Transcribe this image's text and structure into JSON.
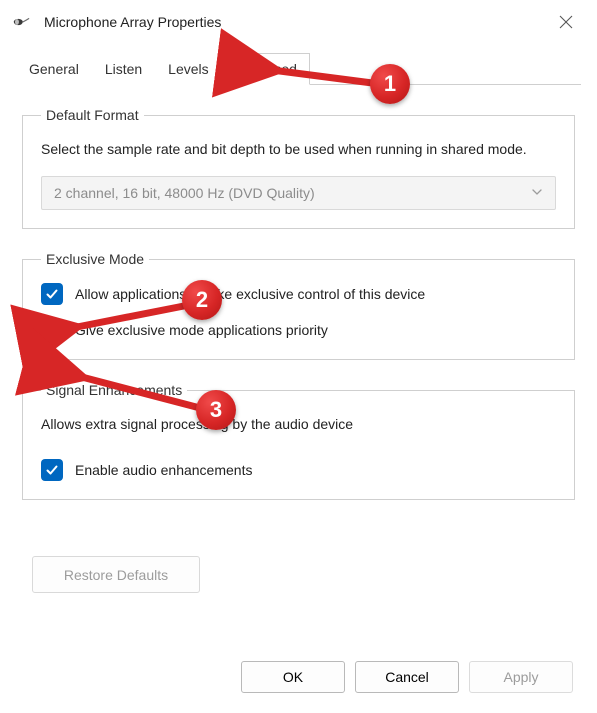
{
  "titlebar": {
    "title": "Microphone Array Properties"
  },
  "tabs": {
    "general": "General",
    "listen": "Listen",
    "levels": "Levels",
    "advanced": "Advanced"
  },
  "defaultFormat": {
    "legend": "Default Format",
    "description": "Select the sample rate and bit depth to be used when running in shared mode.",
    "selectValue": "2 channel, 16 bit, 48000 Hz (DVD Quality)"
  },
  "exclusiveMode": {
    "legend": "Exclusive Mode",
    "allowControl": "Allow applications to take exclusive control of this device",
    "givePriority": "Give exclusive mode applications priority"
  },
  "signalEnhancements": {
    "legend": "Signal Enhancements",
    "description": "Allows extra signal processing by the audio device",
    "enable": "Enable audio enhancements"
  },
  "restoreDefaults": "Restore Defaults",
  "buttons": {
    "ok": "OK",
    "cancel": "Cancel",
    "apply": "Apply"
  },
  "callouts": {
    "one": "1",
    "two": "2",
    "three": "3"
  }
}
